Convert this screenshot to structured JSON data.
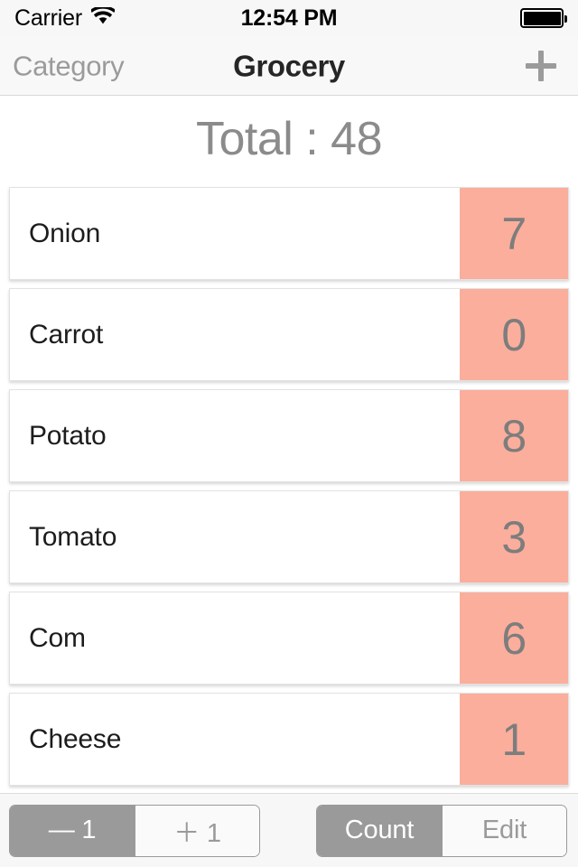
{
  "status_bar": {
    "carrier": "Carrier",
    "wifi_icon": "wifi-icon",
    "time": "12:54 PM",
    "battery_icon": "battery-full-icon"
  },
  "nav_bar": {
    "back_label": "Category",
    "title": "Grocery",
    "add_icon": "plus-icon"
  },
  "header": {
    "total_text": "Total : 48",
    "total_label": "Total",
    "total_value": "48"
  },
  "list": {
    "rows": [
      {
        "name": "Onion",
        "count": "7"
      },
      {
        "name": "Carrot",
        "count": "0"
      },
      {
        "name": "Potato",
        "count": "8"
      },
      {
        "name": "Tomato",
        "count": "3"
      },
      {
        "name": "Com",
        "count": "6"
      },
      {
        "name": "Cheese",
        "count": "1"
      }
    ]
  },
  "toolbar": {
    "step_control": {
      "options": [
        "— 1",
        "＋ 1"
      ],
      "selected_index": 0,
      "decrement_label": "— 1",
      "increment_label": "＋ 1"
    },
    "mode_control": {
      "options": [
        "Count",
        "Edit"
      ],
      "selected_index": 0,
      "count_label": "Count",
      "edit_label": "Edit"
    }
  },
  "colors": {
    "accent_salmon": "#fbae9c",
    "count_text": "#7d7d7d",
    "muted_grey": "#9a9a9a",
    "title_text": "#262626",
    "bar_background": "#f7f7f7"
  }
}
